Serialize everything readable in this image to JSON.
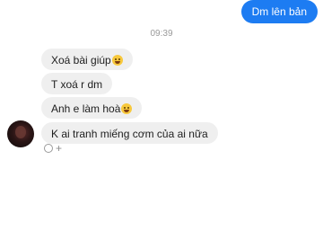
{
  "conversation": {
    "outgoing_messages": [
      {
        "text": "Dm lên bản"
      }
    ],
    "timestamp": "09:39",
    "incoming_messages": [
      {
        "text": "Xoá bài giúp",
        "emoji": "grinning-sweat-emoji"
      },
      {
        "text": "T xoá r dm"
      },
      {
        "text": "Anh e làm hoà",
        "emoji": "laughing-emoji"
      },
      {
        "text": "K ai tranh miếng cơm của ai nữa"
      }
    ],
    "reaction_add_label": "+"
  },
  "colors": {
    "outgoing_bubble": "#1d7cf2",
    "incoming_bubble": "#efefef",
    "timestamp": "#9a9a9a"
  }
}
